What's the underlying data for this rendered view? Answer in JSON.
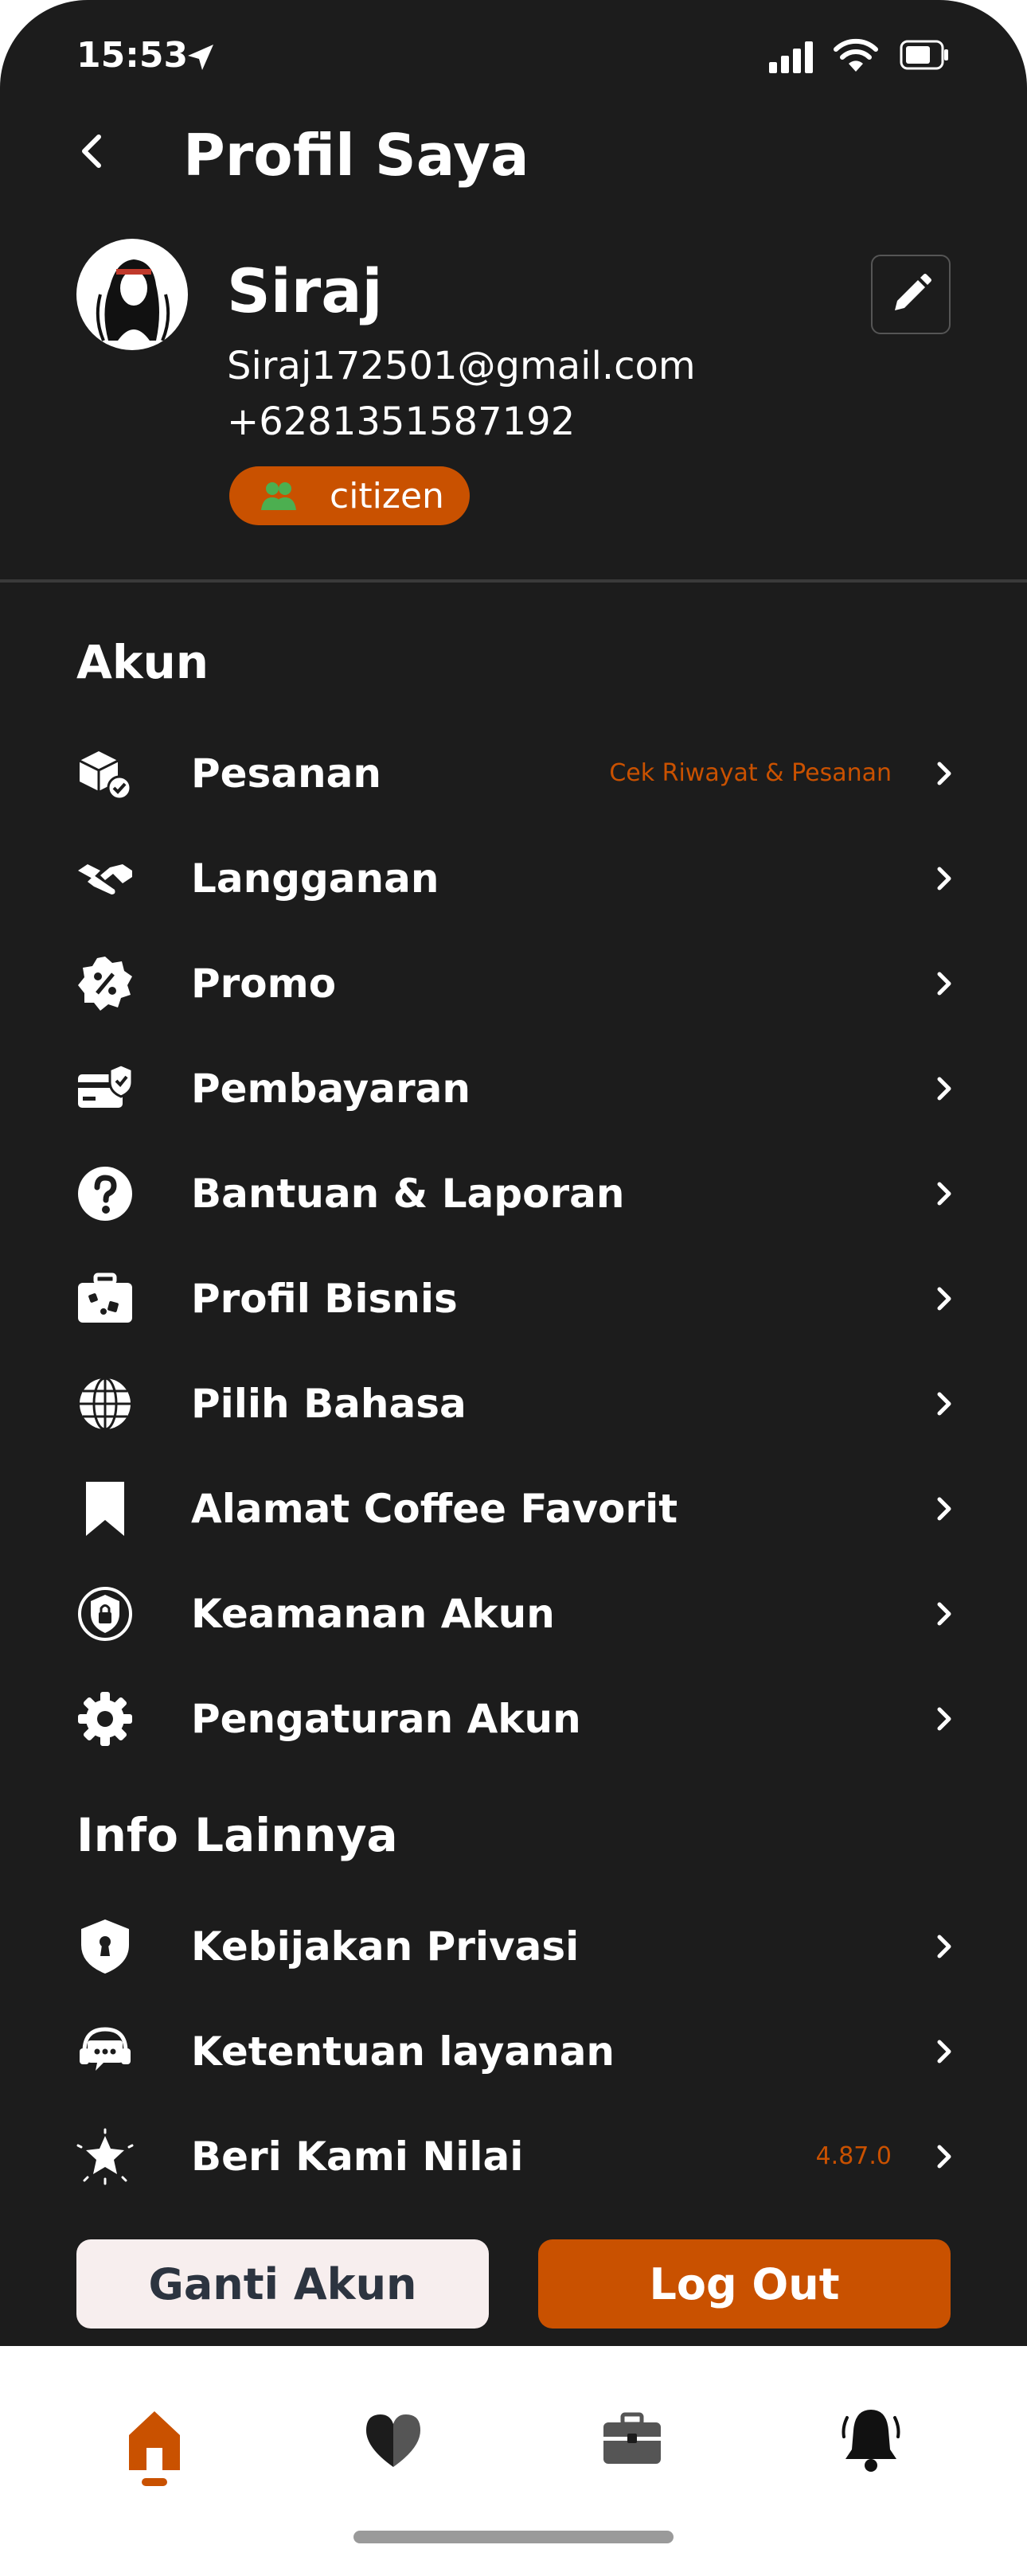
{
  "status_bar": {
    "time": "15:53"
  },
  "header": {
    "title": "Profil Saya"
  },
  "profile": {
    "name": "Siraj",
    "email": "Siraj172501@gmail.com",
    "phone": "+6281351587192",
    "role": "citizen"
  },
  "sections": {
    "account_title": "Akun",
    "other_title": "Info Lainnya"
  },
  "account_items": [
    {
      "label": "Pesanan",
      "note": "Cek Riwayat & Pesanan",
      "icon": "package-check-icon"
    },
    {
      "label": "Langganan",
      "icon": "handshake-icon"
    },
    {
      "label": "Promo",
      "icon": "discount-badge-icon"
    },
    {
      "label": "Pembayaran",
      "icon": "card-shield-icon"
    },
    {
      "label": "Bantuan & Laporan",
      "icon": "help-circle-icon"
    },
    {
      "label": "Profil Bisnis",
      "icon": "suitcase-icon"
    },
    {
      "label": "Pilih Bahasa",
      "icon": "globe-icon"
    },
    {
      "label": "Alamat Coffee Favorit",
      "icon": "bookmark-icon"
    },
    {
      "label": "Keamanan Akun",
      "icon": "shield-lock-icon"
    },
    {
      "label": "Pengaturan Akun",
      "icon": "gear-icon"
    }
  ],
  "other_items": [
    {
      "label": "Kebijakan Privasi",
      "icon": "shield-keyhole-icon"
    },
    {
      "label": "Ketentuan layanan",
      "icon": "support-headset-icon"
    },
    {
      "label": "Beri Kami Nilai",
      "note": "4.87.0",
      "icon": "star-icon"
    }
  ],
  "buttons": {
    "switch_account": "Ganti Akun",
    "logout": "Log Out"
  },
  "tabs": [
    "home-icon",
    "heart-icon",
    "briefcase-icon",
    "bell-icon"
  ],
  "colors": {
    "background": "#1c1c1c",
    "accent": "#c95100",
    "badge_icon": "#4caf50"
  }
}
